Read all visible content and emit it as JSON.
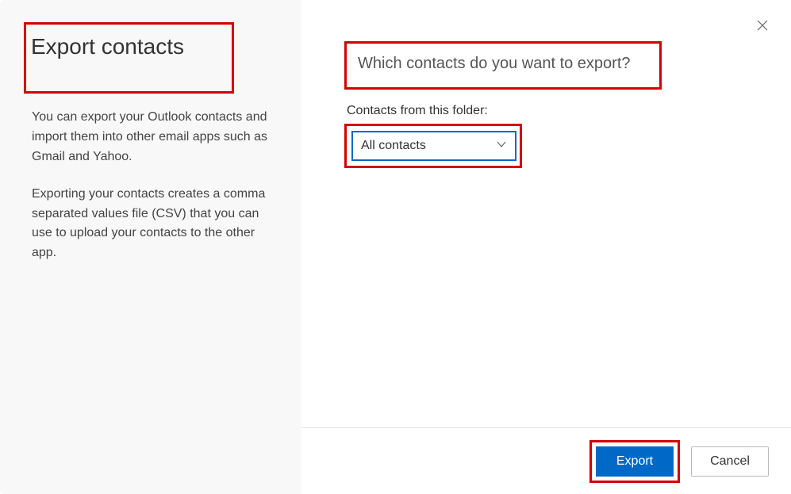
{
  "sidebar": {
    "title": "Export contacts",
    "description1": "You can export your Outlook contacts and import them into other email apps such as Gmail and Yahoo.",
    "description2": "Exporting your contacts creates a comma separated values file (CSV) that you can use to upload your contacts to the other app."
  },
  "main": {
    "question": "Which contacts do you want to export?",
    "folder_label": "Contacts from this folder:",
    "dropdown": {
      "selected": "All contacts"
    }
  },
  "footer": {
    "export_label": "Export",
    "cancel_label": "Cancel"
  }
}
